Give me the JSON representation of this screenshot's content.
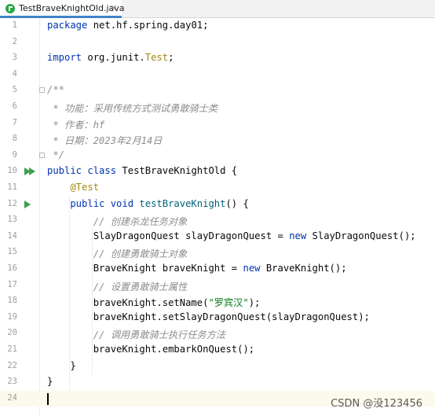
{
  "tab": {
    "filename": "TestBraveKnightOld.java",
    "close_glyph": "×"
  },
  "line_numbers": [
    "1",
    "2",
    "3",
    "4",
    "5",
    "6",
    "7",
    "8",
    "9",
    "10",
    "11",
    "12",
    "13",
    "14",
    "15",
    "16",
    "17",
    "18",
    "19",
    "20",
    "21",
    "22",
    "23",
    "24"
  ],
  "code": {
    "l1_kw": "package",
    "l1_rest": " net.hf.spring.day01;",
    "l3_kw": "import",
    "l3_a": " org.junit.",
    "l3_b": "Test",
    "l3_c": ";",
    "l5": "/**",
    "l6": " * 功能：采用传统方式测试勇敢骑士类",
    "l7": " * 作者：hf",
    "l8": " * 日期：2023年2月14日",
    "l9": " */",
    "l10_kw": "public class",
    "l10_rest": " TestBraveKnightOld {",
    "l11": "    @Test",
    "l12_kw": "    public void",
    "l12_fn": " testBraveKnight",
    "l12_rest": "() {",
    "l13": "        // 创建杀龙任务对象",
    "l14_a": "        SlayDragonQuest slayDragonQuest = ",
    "l14_kw": "new",
    "l14_b": " SlayDragonQuest();",
    "l15": "        // 创建勇敢骑士对象",
    "l16_a": "        BraveKnight braveKnight = ",
    "l16_kw": "new",
    "l16_b": " BraveKnight();",
    "l17": "        // 设置勇敢骑士属性",
    "l18_a": "        braveKnight.setName(",
    "l18_str": "\"罗宾汉\"",
    "l18_b": ");",
    "l19": "        braveKnight.setSlayDragonQuest(slayDragonQuest);",
    "l20": "        // 调用勇敢骑士执行任务方法",
    "l21": "        braveKnight.embarkOnQuest();",
    "l22": "    }",
    "l23": "}"
  },
  "watermark": "CSDN @没123456",
  "colors": {
    "keyword": "#0033b3",
    "annotation": "#9e880d",
    "comment": "#8c8c8c",
    "string": "#067d17",
    "method": "#00627a",
    "run": "#3aa04a",
    "tab_accent": "#4083c9"
  }
}
